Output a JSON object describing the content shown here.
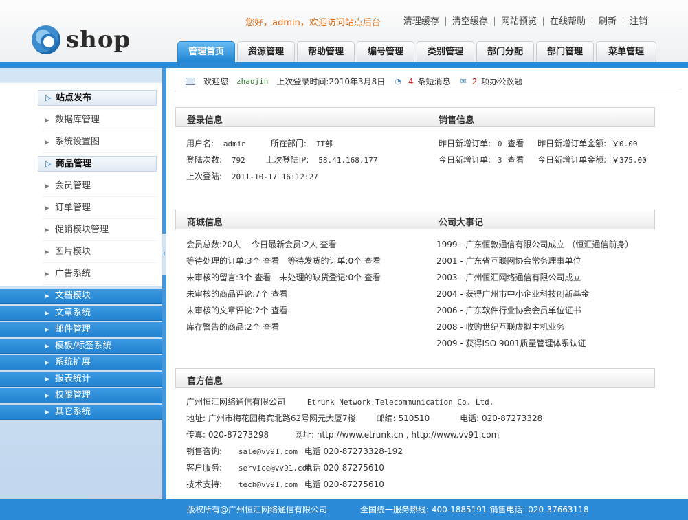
{
  "header": {
    "logo_text": "shop",
    "greeting": "您好，admin，欢迎访问站点后台",
    "links": [
      "清理缓存",
      "清空缓存",
      "网站预览",
      "在线帮助",
      "刷新",
      "注销"
    ],
    "nav": [
      "管理首页",
      "资源管理",
      "帮助管理",
      "编号管理",
      "类别管理",
      "部门分配",
      "部门管理",
      "菜单管理"
    ]
  },
  "sidebar": {
    "section1": {
      "title": "站点发布",
      "items": [
        "数据库管理",
        "系统设置图"
      ]
    },
    "section2": {
      "title": "商品管理",
      "items": [
        "会员管理",
        "订单管理",
        "促销模块管理",
        "图片模块",
        "广告系统"
      ]
    },
    "blue_items": [
      "文档模块",
      "文章系统",
      "邮件管理",
      "模板/标签系统",
      "系统扩展",
      "报表统计",
      "权限管理",
      "其它系统"
    ]
  },
  "welcome": {
    "prefix": "欢迎您",
    "username": "zhaojin",
    "last_login": "上次登录时间:2010年3月8日",
    "msg_count": "4",
    "msg_label": "条短消息",
    "todo_count": "2",
    "todo_label": "项办公议题"
  },
  "login_info": {
    "title": "登录信息",
    "username_label": "用户名:",
    "username": "admin",
    "dept_label": "所在部门:",
    "dept": "IT部",
    "count_label": "登陆次数:",
    "count": "792",
    "last_ip_label": "上次登陆IP:",
    "last_ip": "58.41.168.177",
    "last_login_label": "上次登陆:",
    "last_login": "2011-10-17 16:12:27"
  },
  "sales_info": {
    "title": "销售信息",
    "row1_label": "昨日新增订单:",
    "row1_val": "0",
    "row1_amount_label": "昨日新增订单金额:",
    "row1_amount": "￥0.00",
    "row2_label": "今日新增订单:",
    "row2_val": "3",
    "row2_amount_label": "今日新增订单金额:",
    "row2_amount": "￥375.00",
    "view": "查看"
  },
  "mall_info": {
    "title": "商城信息",
    "rows": [
      "会员总数:20人　 今日最新会员:2人 查看",
      "等待处理的订单:3个 查看　等待发货的订单:0个 查看",
      "未审核的留言:3个 查看　未处理的缺货登记:0个 查看",
      "未审核的商品评论:7个 查看",
      "未审核的文章评论:2个 查看",
      "库存警告的商品:2个 查看"
    ]
  },
  "events": {
    "title": "公司大事记",
    "rows": [
      "1999 - 广东恒敦通信有限公司成立 （恒汇通信前身）",
      "2001 - 广东省互联网协会常务理事单位",
      "2003 - 广州恒汇网络通信有限公司成立",
      "2004 - 获得广州市中小企业科技创新基金",
      "2006 - 广东软件行业协会会员单位证书",
      "2008 - 收购世纪互联虚拟主机业务",
      "2009 - 获得ISO 9001质量管理体系认证"
    ]
  },
  "official": {
    "title": "官方信息",
    "company": "广州恒汇网络通信有限公司",
    "company_en": "Etrunk Network Telecommunication Co. Ltd.",
    "address": "地址: 广州市梅花园梅宾北路62号网元大厦7楼",
    "zip": "邮编: 510510",
    "phone": "电话: 020-87273328",
    "fax": "传真: 020-87273298",
    "site": "网址: http://www.etrunk.cn , http://www.vv91.com",
    "sales_label": "销售咨询:",
    "sales_email": "sale@vv91.com",
    "sales_phone": "电话 020-87273328-192",
    "service_label": "客户服务:",
    "service_email": "service@vv91.com",
    "service_phone": "电话 020-87275610",
    "tech_label": "技术支持:",
    "tech_email": "tech@vv91.com",
    "tech_phone": "电话 020-87275610"
  },
  "footer": {
    "copyright": "版权所有@广州恒汇网络通信有限公司",
    "hotline": "全国统一服务热线: 400-1885191 销售电话: 020-37663118"
  }
}
